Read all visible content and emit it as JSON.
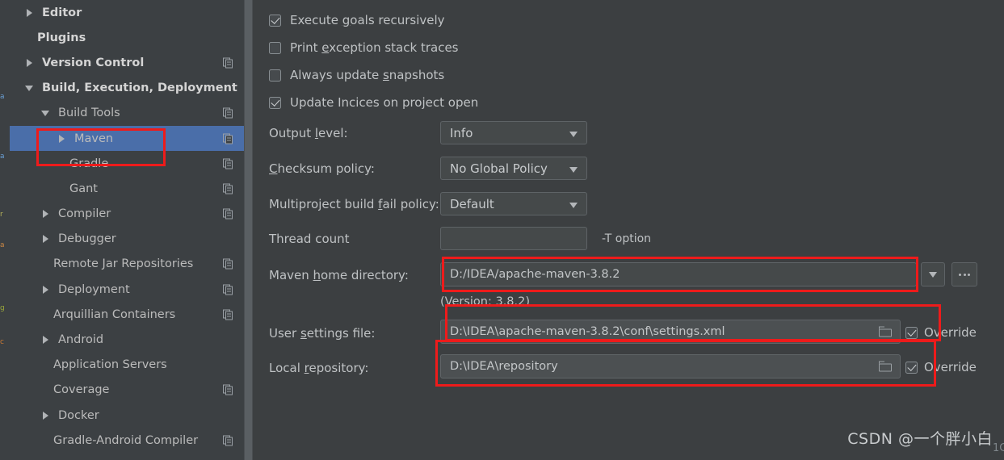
{
  "window": {
    "app": "IntelliJ IDEA Settings",
    "section": "Build, Execution, Deployment > Build Tools > Maven"
  },
  "colors": {
    "background": "#3c3f41",
    "sidebar_background": "#3c4043",
    "selection_blue": "#4a6ea9",
    "annotation_red": "#ee1b1b",
    "field_background": "#45494a",
    "path_field_background": "#4c5052",
    "text": "#bfc2c4"
  },
  "sidebar": {
    "items": [
      {
        "label": "Editor",
        "arrow": "right",
        "indent": 18,
        "bold": true,
        "copy_icon": false,
        "selected": false
      },
      {
        "label": "Plugins",
        "arrow": "none",
        "indent": 34,
        "bold": true,
        "copy_icon": false,
        "selected": false
      },
      {
        "label": "Version Control",
        "arrow": "right",
        "indent": 18,
        "bold": true,
        "copy_icon": true,
        "selected": false
      },
      {
        "label": "Build, Execution, Deployment",
        "arrow": "down",
        "indent": 18,
        "bold": true,
        "copy_icon": false,
        "selected": false
      },
      {
        "label": "Build Tools",
        "arrow": "down",
        "indent": 38,
        "bold": false,
        "copy_icon": true,
        "selected": false
      },
      {
        "label": "Maven",
        "arrow": "right",
        "indent": 58,
        "bold": false,
        "copy_icon": true,
        "selected": true
      },
      {
        "label": "Gradle",
        "arrow": "none",
        "indent": 74,
        "bold": false,
        "copy_icon": true,
        "selected": false
      },
      {
        "label": "Gant",
        "arrow": "none",
        "indent": 74,
        "bold": false,
        "copy_icon": true,
        "selected": false
      },
      {
        "label": "Compiler",
        "arrow": "right",
        "indent": 38,
        "bold": false,
        "copy_icon": true,
        "selected": false
      },
      {
        "label": "Debugger",
        "arrow": "right",
        "indent": 38,
        "bold": false,
        "copy_icon": false,
        "selected": false
      },
      {
        "label": "Remote Jar Repositories",
        "arrow": "none",
        "indent": 54,
        "bold": false,
        "copy_icon": true,
        "selected": false
      },
      {
        "label": "Deployment",
        "arrow": "right",
        "indent": 38,
        "bold": false,
        "copy_icon": true,
        "selected": false
      },
      {
        "label": "Arquillian Containers",
        "arrow": "none",
        "indent": 54,
        "bold": false,
        "copy_icon": true,
        "selected": false
      },
      {
        "label": "Android",
        "arrow": "right",
        "indent": 38,
        "bold": false,
        "copy_icon": false,
        "selected": false
      },
      {
        "label": "Application Servers",
        "arrow": "none",
        "indent": 54,
        "bold": false,
        "copy_icon": false,
        "selected": false
      },
      {
        "label": "Coverage",
        "arrow": "none",
        "indent": 54,
        "bold": false,
        "copy_icon": true,
        "selected": false
      },
      {
        "label": "Docker",
        "arrow": "right",
        "indent": 38,
        "bold": false,
        "copy_icon": false,
        "selected": false
      },
      {
        "label": "Gradle-Android Compiler",
        "arrow": "none",
        "indent": 54,
        "bold": false,
        "copy_icon": true,
        "selected": false
      }
    ]
  },
  "main": {
    "checkboxes": [
      {
        "label_pre": "Execute ",
        "mnemonic": "g",
        "label_post": "oals recursively",
        "checked": true
      },
      {
        "label_pre": "Print ",
        "mnemonic": "e",
        "label_post": "xception stack traces",
        "checked": false
      },
      {
        "label_pre": "Always update ",
        "mnemonic": "s",
        "label_post": "napshots",
        "checked": false
      },
      {
        "label_pre": "Update Incices on project open",
        "mnemonic": "",
        "label_post": "",
        "checked": true
      }
    ],
    "output_level": {
      "label_pre": "Output ",
      "mnemonic": "l",
      "label_post": "evel:",
      "value": "Info"
    },
    "checksum_policy": {
      "label_pre": "",
      "mnemonic": "C",
      "label_post": "hecksum policy:",
      "value": "No Global Policy"
    },
    "multiproject_fail_policy": {
      "label_pre": "Multiproject build ",
      "mnemonic": "f",
      "label_post": "ail policy:",
      "value": "Default"
    },
    "thread_count": {
      "label": "Thread count",
      "value": "",
      "hint": "-T option"
    },
    "maven_home": {
      "label_pre": "Maven ",
      "mnemonic": "h",
      "label_post": "ome directory:",
      "value": "D:/IDEA/apache-maven-3.8.2",
      "version_note": "(Version: 3.8.2)",
      "dropdown_icon": "chevron-down-icon",
      "browse_icon": "ellipsis-icon"
    },
    "user_settings_file": {
      "label_pre": "User ",
      "mnemonic": "s",
      "label_post": "ettings file:",
      "value": "D:\\IDEA\\apache-maven-3.8.2\\conf\\settings.xml",
      "override_label": "Override",
      "override_checked": true
    },
    "local_repository": {
      "label_pre": "Local ",
      "mnemonic": "r",
      "label_post": "epository:",
      "value": "D:\\IDEA\\repository",
      "override_label": "Override",
      "override_checked": true
    }
  },
  "watermark": {
    "text": "CSDN @一个胖小白"
  }
}
